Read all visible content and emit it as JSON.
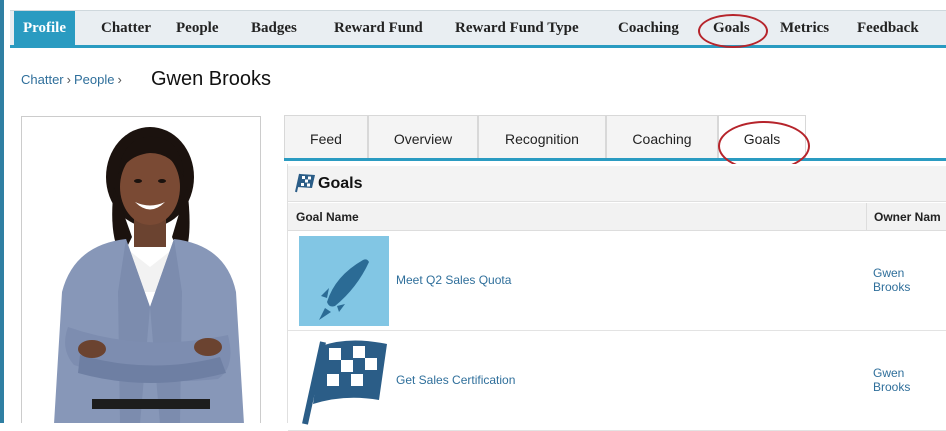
{
  "top_tabs": [
    "Profile",
    "Chatter",
    "People",
    "Badges",
    "Reward Fund",
    "Reward Fund Type",
    "Coaching",
    "Goals",
    "Metrics",
    "Feedback"
  ],
  "breadcrumb": {
    "parts": [
      "Chatter",
      "People"
    ],
    "current": "Gwen Brooks"
  },
  "profile_tabs": [
    "Feed",
    "Overview",
    "Recognition",
    "Coaching",
    "Goals"
  ],
  "goals_panel": {
    "title": "Goals",
    "columns": [
      "Goal Name",
      "Owner Nam"
    ],
    "rows": [
      {
        "goal": "Meet Q2 Sales Quota",
        "owner_first": "Gwen",
        "owner_last": "Brooks",
        "icon": "rocket-icon"
      },
      {
        "goal": "Get Sales Certification",
        "owner_first": "Gwen",
        "owner_last": "Brooks",
        "icon": "checkered-flag-icon"
      }
    ]
  },
  "colors": {
    "accent": "#2a9bc1",
    "highlight_circle": "#b6242b",
    "link": "#2f6f9b"
  }
}
